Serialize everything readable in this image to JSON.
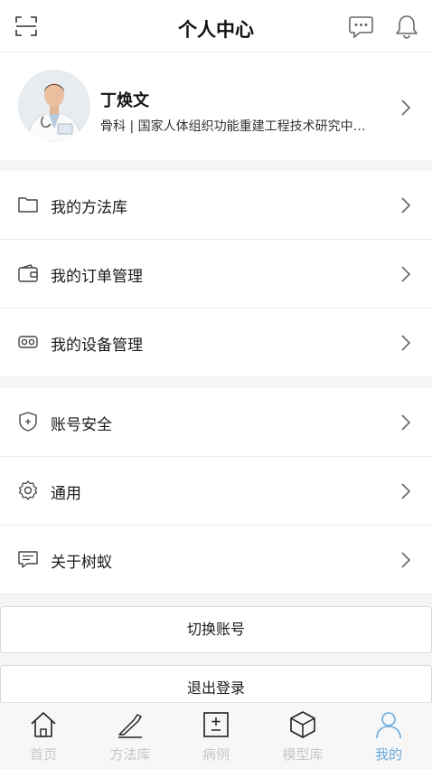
{
  "header": {
    "title": "个人中心",
    "icons": [
      "scan-icon",
      "message-icon",
      "bell-icon"
    ]
  },
  "profile": {
    "name": "丁焕文",
    "description": "骨科 | 国家人体组织功能重建工程技术研究中…"
  },
  "menu_group_1": [
    {
      "label": "我的方法库",
      "icon": "folder-icon"
    },
    {
      "label": "我的订单管理",
      "icon": "wallet-icon"
    },
    {
      "label": "我的设备管理",
      "icon": "vr-headset-icon"
    }
  ],
  "menu_group_2": [
    {
      "label": "账号安全",
      "icon": "shield-icon"
    },
    {
      "label": "通用",
      "icon": "gear-icon"
    },
    {
      "label": "关于树蚁",
      "icon": "info-message-icon"
    }
  ],
  "buttons": {
    "switch_account": "切换账号",
    "logout": "退出登录"
  },
  "tabbar": [
    {
      "label": "首页",
      "icon": "home-icon",
      "active": false
    },
    {
      "label": "方法库",
      "icon": "scalpel-icon",
      "active": false
    },
    {
      "label": "病例",
      "icon": "case-icon",
      "active": false
    },
    {
      "label": "模型库",
      "icon": "cube-icon",
      "active": false
    },
    {
      "label": "我的",
      "icon": "person-icon",
      "active": true
    }
  ],
  "colors": {
    "active_tab": "#6aa9dc",
    "inactive_tab": "#c7c7c7",
    "section_gap": "#f5f5f5"
  }
}
